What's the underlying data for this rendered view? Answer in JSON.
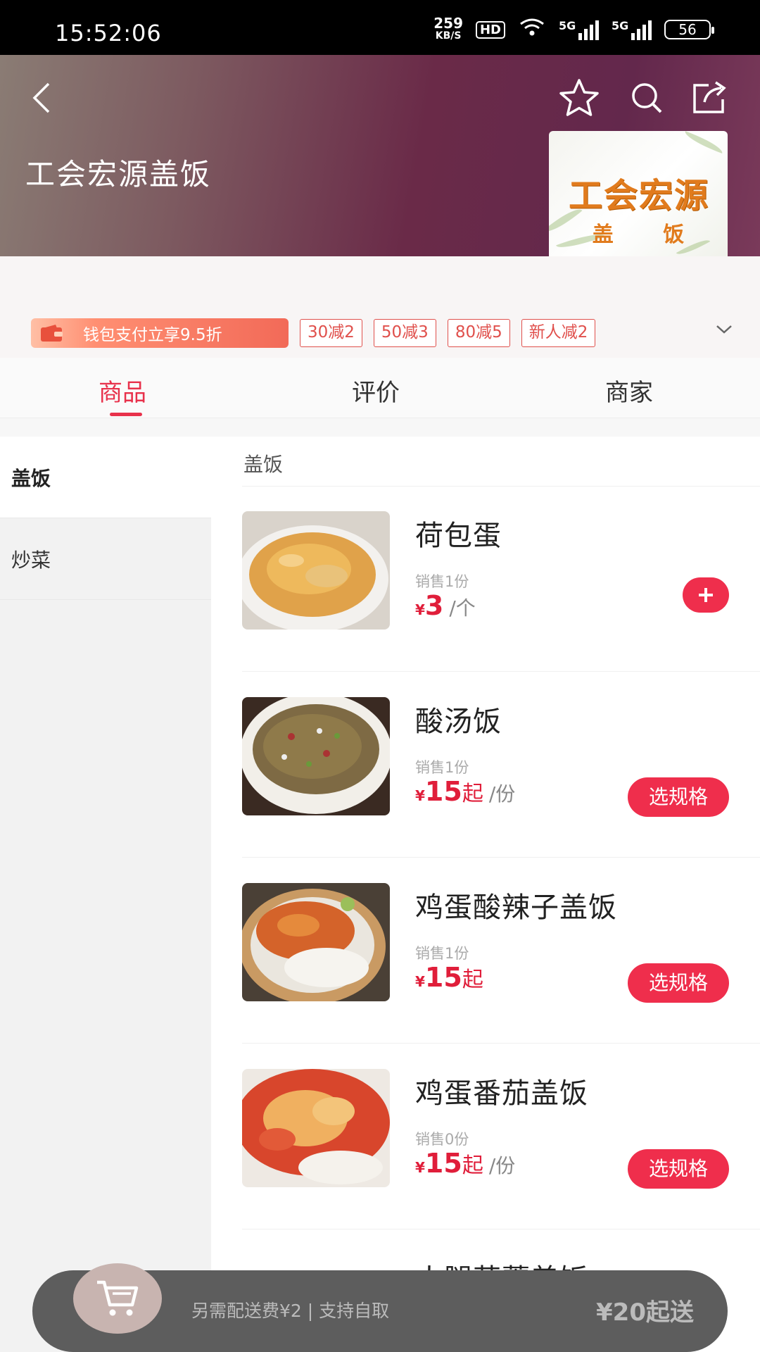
{
  "status_bar": {
    "time": "15:52:06",
    "speed_value": "259",
    "speed_unit": "KB/S",
    "hd_label": "HD",
    "sim1_label": "5G",
    "sim2_label": "5G",
    "battery": "56"
  },
  "header": {
    "store_name": "工会宏源盖饭",
    "logo_line1": "工会宏源",
    "logo_line2": "盖 饭"
  },
  "promotions": {
    "wallet_text": "钱包支付立享9.5折",
    "tags": [
      "30减2",
      "50减3",
      "80减5",
      "新人减2"
    ]
  },
  "tabs": [
    {
      "label": "商品",
      "active": true
    },
    {
      "label": "评价",
      "active": false
    },
    {
      "label": "商家",
      "active": false
    }
  ],
  "sidebar": {
    "items": [
      {
        "label": "盖饭",
        "active": true
      },
      {
        "label": "炒菜",
        "active": false
      }
    ]
  },
  "menu": {
    "section_title": "盖饭",
    "items": [
      {
        "name": "荷包蛋",
        "sold": "销售1份",
        "currency": "¥",
        "price": "3",
        "suffix": "",
        "unit": "/个",
        "action": "add"
      },
      {
        "name": "酸汤饭",
        "sold": "销售1份",
        "currency": "¥",
        "price": "15",
        "suffix": "起",
        "unit": "/份",
        "action": "选规格"
      },
      {
        "name": "鸡蛋酸辣子盖饭",
        "sold": "销售1份",
        "currency": "¥",
        "price": "15",
        "suffix": "起",
        "unit": "",
        "action": "选规格"
      },
      {
        "name": "鸡蛋番茄盖饭",
        "sold": "销售0份",
        "currency": "¥",
        "price": "15",
        "suffix": "起",
        "unit": "/份",
        "action": "选规格"
      },
      {
        "name": "火腿蒜薹盖饭"
      }
    ]
  },
  "cart": {
    "info": "另需配送费¥2 | 支持自取",
    "min_order": "¥20起送"
  },
  "colors": {
    "accent": "#ef2e4c",
    "tag_border": "#e0504c",
    "cart_bar": "#5d5d5d"
  }
}
